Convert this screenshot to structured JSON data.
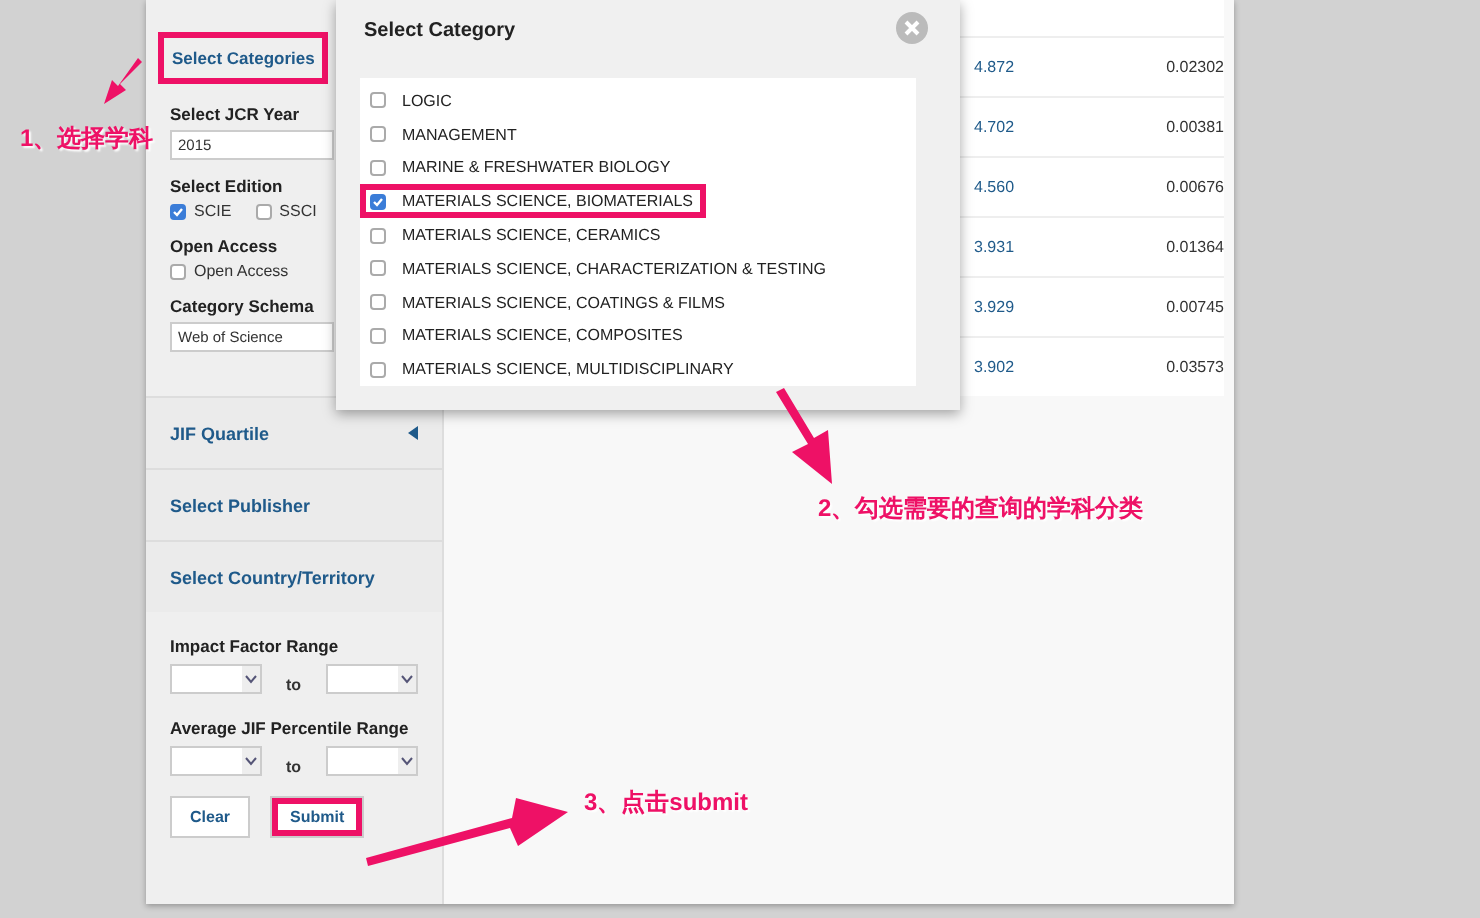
{
  "sidebar": {
    "header": {
      "label": "Select Categories",
      "highlighted": true
    },
    "jcr_year": {
      "label": "Select JCR Year",
      "value": "2015"
    },
    "edition": {
      "label": "Select Edition",
      "options": [
        {
          "label": "SCIE",
          "checked": true
        },
        {
          "label": "SSCI",
          "checked": false
        }
      ]
    },
    "open_access": {
      "label": "Open Access",
      "options": [
        {
          "label": "Open Access",
          "checked": false
        }
      ]
    },
    "category_schema": {
      "label": "Category Schema",
      "value": "Web of Science"
    },
    "sections": [
      {
        "label": "JIF Quartile",
        "kind": "expandable"
      },
      {
        "label": "Select Publisher",
        "kind": "link"
      },
      {
        "label": "Select Country/Territory",
        "kind": "link"
      }
    ],
    "ranges": [
      {
        "label": "Impact Factor Range",
        "separator": "to"
      },
      {
        "label": "Average JIF Percentile Range",
        "separator": "to"
      }
    ],
    "buttons": [
      {
        "label": "Clear",
        "highlighted": false
      },
      {
        "label": "Submit",
        "highlighted": true
      }
    ]
  },
  "table": {
    "rows": [
      {
        "column_1": "4.872",
        "column_2": "0.02302"
      },
      {
        "column_1": "4.702",
        "column_2": "0.00381"
      },
      {
        "column_1": "4.560",
        "column_2": "0.00676"
      },
      {
        "column_1": "3.931",
        "column_2": "0.01364"
      },
      {
        "column_1": "3.929",
        "column_2": "0.00745"
      },
      {
        "column_1": "3.902",
        "column_2": "0.03573"
      }
    ]
  },
  "modal": {
    "title": "Select Category",
    "items": [
      {
        "label": "LOGIC",
        "checked": false,
        "highlighted": false
      },
      {
        "label": "MANAGEMENT",
        "checked": false,
        "highlighted": false
      },
      {
        "label": "MARINE & FRESHWATER BIOLOGY",
        "checked": false,
        "highlighted": false
      },
      {
        "label": "MATERIALS SCIENCE, BIOMATERIALS",
        "checked": true,
        "highlighted": true
      },
      {
        "label": "MATERIALS SCIENCE, CERAMICS",
        "checked": false,
        "highlighted": false
      },
      {
        "label": "MATERIALS SCIENCE, CHARACTERIZATION & TESTING",
        "checked": false,
        "highlighted": false
      },
      {
        "label": "MATERIALS SCIENCE, COATINGS & FILMS",
        "checked": false,
        "highlighted": false
      },
      {
        "label": "MATERIALS SCIENCE, COMPOSITES",
        "checked": false,
        "highlighted": false
      },
      {
        "label": "MATERIALS SCIENCE, MULTIDISCIPLINARY",
        "checked": false,
        "highlighted": false
      }
    ]
  },
  "annotations": [
    {
      "text": "1、选择学科"
    },
    {
      "text": "2、勾选需要的查询的学科分类"
    },
    {
      "text": "3、点击submit"
    }
  ]
}
